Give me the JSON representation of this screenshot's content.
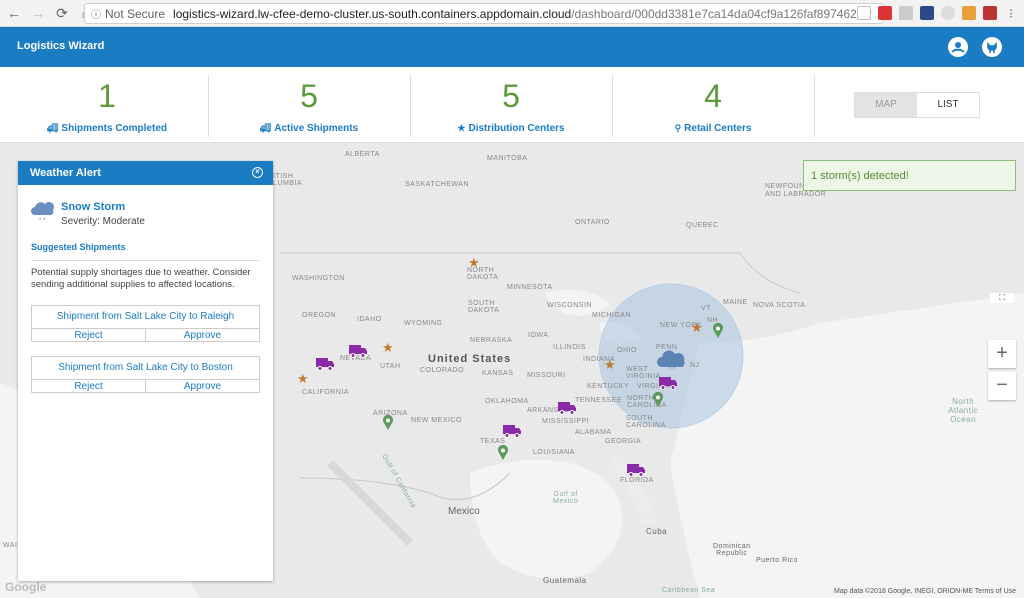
{
  "browser": {
    "security": "Not Secure",
    "url_domain": "logistics-wizard.lw-cfee-demo-cluster.us-south.containers.appdomain.cloud",
    "url_path": "/dashboard/000dd3381e7ca14da04cf9a126faf897462"
  },
  "app": {
    "title": "Logistics Wizard"
  },
  "stats": [
    {
      "value": "1",
      "label": "Shipments Completed",
      "icon": "truck-icon"
    },
    {
      "value": "5",
      "label": "Active Shipments",
      "icon": "truck-icon"
    },
    {
      "value": "5",
      "label": "Distribution Centers",
      "icon": "star-icon"
    },
    {
      "value": "4",
      "label": "Retail Centers",
      "icon": "pin-icon"
    }
  ],
  "view_toggle": {
    "map": "MAP",
    "list": "LIST"
  },
  "alert": {
    "title": "Weather Alert",
    "storm_name": "Snow Storm",
    "severity": "Severity: Moderate",
    "suggested_title": "Suggested Shipments",
    "suggested_text": "Potential supply shortages due to weather. Consider sending additional supplies to affected locations.",
    "shipments": [
      {
        "title": "Shipment from Salt Lake City to Raleigh",
        "reject": "Reject",
        "approve": "Approve"
      },
      {
        "title": "Shipment from Salt Lake City to Boston",
        "reject": "Reject",
        "approve": "Approve"
      }
    ]
  },
  "toast": "1 storm(s) detected!",
  "map": {
    "labels": {
      "alberta": "ALBERTA",
      "manitoba": "MANITOBA",
      "saskatchewan": "SASKATCHEWAN",
      "ontario": "ONTARIO",
      "quebec": "QUEBEC",
      "newfoundland": "NEWFOUNDLAND",
      "labrador": "AND LABRADOR",
      "british_columbia": "ITISH\nLUMBIA",
      "washington": "WASHINGTON",
      "oregon": "OREGON",
      "idaho": "IDAHO",
      "wyoming": "WYOMING",
      "nevada": "NEVADA",
      "utah": "UTAH",
      "california": "CALIFORNIA",
      "arizona": "ARIZONA",
      "new_mexico": "NEW MEXICO",
      "colorado": "COLORADO",
      "north_dakota": "NORTH\nDAKOTA",
      "south_dakota": "SOUTH\nDAKOTA",
      "nebraska": "NEBRASKA",
      "kansas": "KANSAS",
      "oklahoma": "OKLAHOMA",
      "texas": "TEXAS",
      "minnesota": "MINNESOTA",
      "iowa": "IOWA",
      "missouri": "MISSOURI",
      "arkansas": "ARKANSAS",
      "louisiana": "LOUISIANA",
      "wisconsin": "WISCONSIN",
      "illinois": "ILLINOIS",
      "mississippi": "MISSISSIPPI",
      "alabama": "ALABAMA",
      "georgia": "GEORGIA",
      "florida": "FLORIDA",
      "tennessee": "TENNESSEE",
      "kentucky": "KENTUCKY",
      "indiana": "INDIANA",
      "ohio": "OHIO",
      "michigan": "MICHIGAN",
      "penn": "PENN",
      "west_virginia": "WEST\nVIRGINIA",
      "virginia": "VIRGINIA",
      "north_carolina": "NORTH\nCAROLINA",
      "south_carolina": "SOUTH\nCAROLINA",
      "new_york": "NEW YORK",
      "nj": "NJ",
      "vt": "VT",
      "nh": "NH",
      "maine": "MAINE",
      "nova_scotia": "NOVA SCOTIA",
      "united_states": "United States",
      "mexico": "Mexico",
      "gulf_of_california": "Gulf of California",
      "gulf_of_mexico": "Gulf of\nMexico",
      "cuba": "Cuba",
      "dominican_republic": "Dominican\nRepublic",
      "puerto_rico": "Puerto Rico",
      "north_atlantic": "North\nAtlantic\nOcean",
      "guatemala": "Guatemala",
      "caribbean": "Caribbean Sea",
      "hawaii_fragment": "WAI"
    },
    "zoom_in": "+",
    "zoom_out": "−",
    "fullscreen": "⛶",
    "google": "Google",
    "credit": "Map data ©2018 Google, INEGI, ORION-ME    Terms of Use"
  },
  "colors": {
    "brand": "#1a7cc2",
    "stat_number": "#5a9a3b",
    "truck": "#8a2aa8",
    "star": "#c07a2a",
    "pin": "#5a9a5a",
    "storm": "#a9c5e0"
  }
}
